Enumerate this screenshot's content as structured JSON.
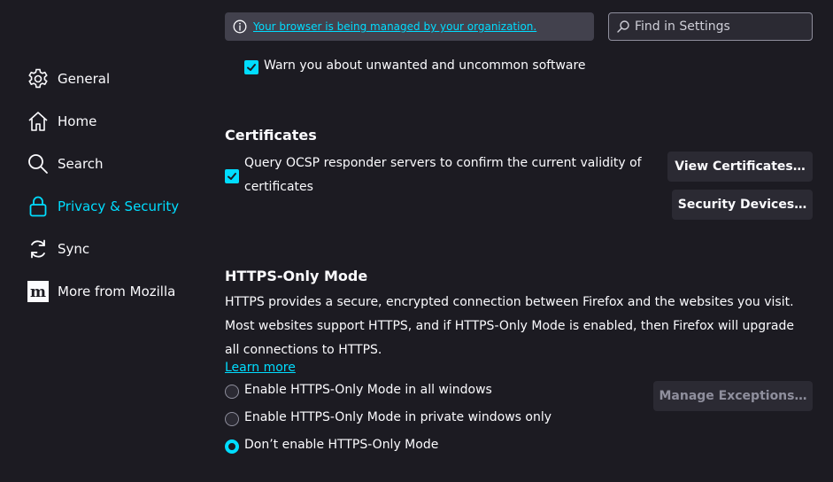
{
  "sidebar": {
    "items": [
      {
        "label": "General",
        "icon": "gear-icon",
        "active": false
      },
      {
        "label": "Home",
        "icon": "home-icon",
        "active": false
      },
      {
        "label": "Search",
        "icon": "search-icon",
        "active": false
      },
      {
        "label": "Privacy & Security",
        "icon": "lock-icon",
        "active": true
      },
      {
        "label": "Sync",
        "icon": "sync-icon",
        "active": false
      },
      {
        "label": "More from Mozilla",
        "icon": "mozilla-logo-icon",
        "active": false
      }
    ]
  },
  "topbar": {
    "managed_text": "Your browser is being managed by your organization.",
    "search_placeholder": "Find in Settings"
  },
  "content": {
    "partial_checkbox_label": "Warn you about unwanted and uncommon software",
    "certificates": {
      "heading": "Certificates",
      "ocsp_line1": "Query OCSP responder servers to confirm the current validity of",
      "ocsp_line2": "certificates",
      "ocsp_checked": true,
      "view_certificates": "View Certificates…",
      "security_devices": "Security Devices…"
    },
    "https_only": {
      "heading": "HTTPS-Only Mode",
      "description": "HTTPS provides a secure, encrypted connection between Firefox and the websites you visit. Most websites support HTTPS, and if HTTPS-Only Mode is enabled, then Firefox will upgrade all connections to HTTPS.",
      "learn_more": "Learn more",
      "options": [
        {
          "label": "Enable HTTPS-Only Mode in all windows",
          "checked": false
        },
        {
          "label": "Enable HTTPS-Only Mode in private windows only",
          "checked": false
        },
        {
          "label": "Don’t enable HTTPS-Only Mode",
          "checked": true
        }
      ],
      "manage_exceptions": "Manage Exceptions…"
    }
  },
  "colors": {
    "background": "#1c1b22",
    "accent": "#00ddff",
    "button_bg": "#2b2a33",
    "text": "#fbfbfe"
  }
}
